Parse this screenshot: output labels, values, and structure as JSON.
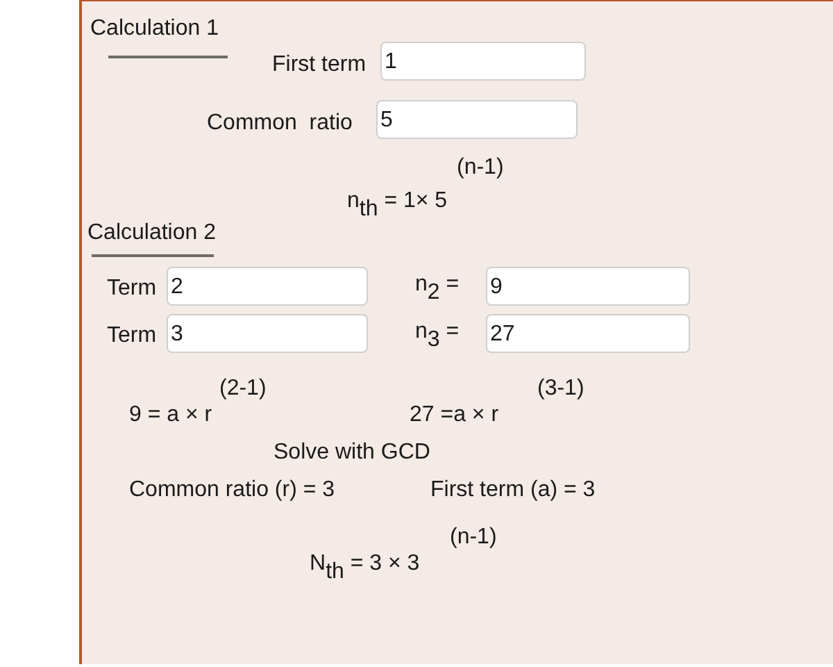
{
  "calculation_1": {
    "title": "Calculation 1",
    "fields": [
      {
        "label": "First term",
        "value": "1"
      },
      {
        "label": "Common  ratio",
        "value": "5"
      }
    ],
    "formula": {
      "exponent": "(n-1)",
      "expression": "n$_{th}$ = 1× 5"
    }
  },
  "calculation_2": {
    "title": "Calculation 2",
    "terms": [
      {
        "label": "Term",
        "value": "2",
        "result_label": "n$_{2}$ =",
        "result_value": "9"
      },
      {
        "label": "Term",
        "value": "3",
        "result_label": "n$_{3}$ =",
        "result_value": "27"
      }
    ],
    "equations": [
      {
        "expression": "9 = a × r",
        "exponent": "(2-1)"
      },
      {
        "expression": "27 =a × r",
        "exponent": "(3-1)"
      }
    ],
    "method": "Solve with GCD",
    "results": [
      "Common ratio (r) = 3",
      "First term (a) = 3"
    ],
    "formula": {
      "exponent": "(n-1)",
      "expression": "N$_{th}$ = 3 × 3"
    }
  }
}
